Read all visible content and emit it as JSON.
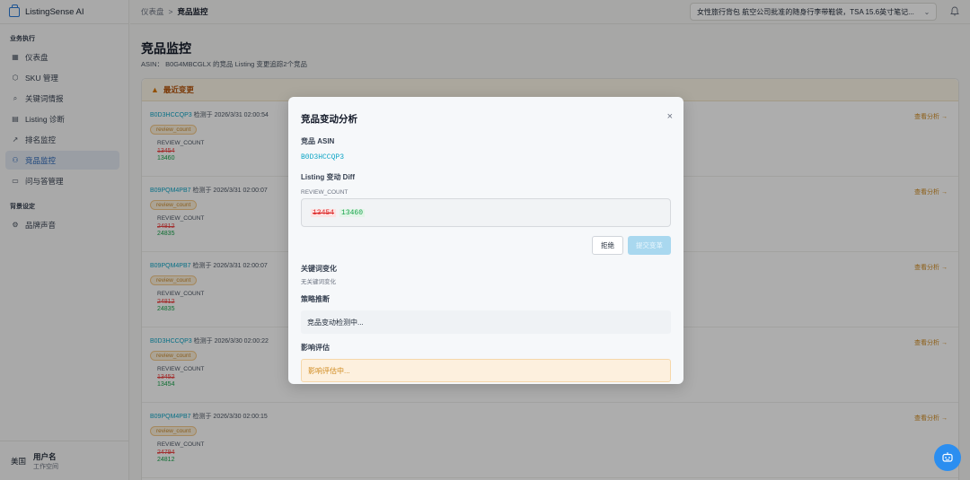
{
  "app": {
    "name": "ListingSense AI"
  },
  "sidebar": {
    "section_ops": "业务执行",
    "items": [
      {
        "label": "仪表盘",
        "icon": "grid-icon"
      },
      {
        "label": "SKU 管理",
        "icon": "box-icon"
      },
      {
        "label": "关键词情报",
        "icon": "search-icon"
      },
      {
        "label": "Listing 诊断",
        "icon": "document-icon"
      },
      {
        "label": "排名监控",
        "icon": "trend-icon"
      },
      {
        "label": "竞品监控",
        "icon": "users-icon",
        "active": true
      },
      {
        "label": "问与答管理",
        "icon": "qa-icon"
      }
    ],
    "section_settings": "背景设定",
    "settings_items": [
      {
        "label": "品牌声音",
        "icon": "gear-icon"
      }
    ],
    "user": {
      "country": "美国",
      "name": "用户名",
      "workspace": "工作空间"
    }
  },
  "header": {
    "breadcrumb_root": "仪表盘",
    "breadcrumb_sep": ">",
    "breadcrumb_current": "竞品监控",
    "product_selector": "女性旅行背包 航空公司批准的随身行李带鞋袋，TSA 15.6英寸笔记..."
  },
  "page": {
    "title": "竞品监控",
    "subtitle": "ASIN： B0G4MBCGLX 的竞品 Listing 变更追踪2个竞品",
    "recent_changes_label": "最近变更",
    "view_analysis": "查看分析 →",
    "changes": [
      {
        "asin": "B0D3HCCQP3",
        "detected": "检测于 2026/3/31 02:00:54",
        "tag": "review_count",
        "field": "REVIEW_COUNT",
        "old": "13454",
        "new": "13460"
      },
      {
        "asin": "B09PQM4PB7",
        "detected": "检测于 2026/3/31 02:00:07",
        "tag": "review_count",
        "field": "REVIEW_COUNT",
        "old": "24812",
        "new": "24835"
      },
      {
        "asin": "B09PQM4PB7",
        "detected": "检测于 2026/3/31 02:00:07",
        "tag": "review_count",
        "field": "REVIEW_COUNT",
        "old": "24812",
        "new": "24835"
      },
      {
        "asin": "B0D3HCCQP3",
        "detected": "检测于 2026/3/30 02:00:22",
        "tag": "review_count",
        "field": "REVIEW_COUNT",
        "old": "13452",
        "new": "13454"
      },
      {
        "asin": "B09PQM4PB7",
        "detected": "检测于 2026/3/30 02:00:15",
        "tag": "review_count",
        "field": "REVIEW_COUNT",
        "old": "24794",
        "new": "24812"
      }
    ]
  },
  "modal": {
    "title": "竞品变动分析",
    "close": "×",
    "asin_label": "竞品 ASIN",
    "asin": "B0D3HCCQP3",
    "diff_label": "Listing 变动 Diff",
    "diff_field": "REVIEW_COUNT",
    "diff_old": "13454",
    "diff_new": "13460",
    "reject": "拒绝",
    "submit": "提交变革",
    "keyword_label": "关键词变化",
    "keyword_note": "无关键词变化",
    "strategy_label": "策略推断",
    "strategy_text": "竞品变动检测中...",
    "impact_label": "影响评估",
    "impact_text": "影响评估中..."
  },
  "colors": {
    "accent": "#2b8ef0",
    "asin": "#0ea5c6",
    "warning": "#d08a1e",
    "old": "#dc2626",
    "new": "#16a34a"
  }
}
